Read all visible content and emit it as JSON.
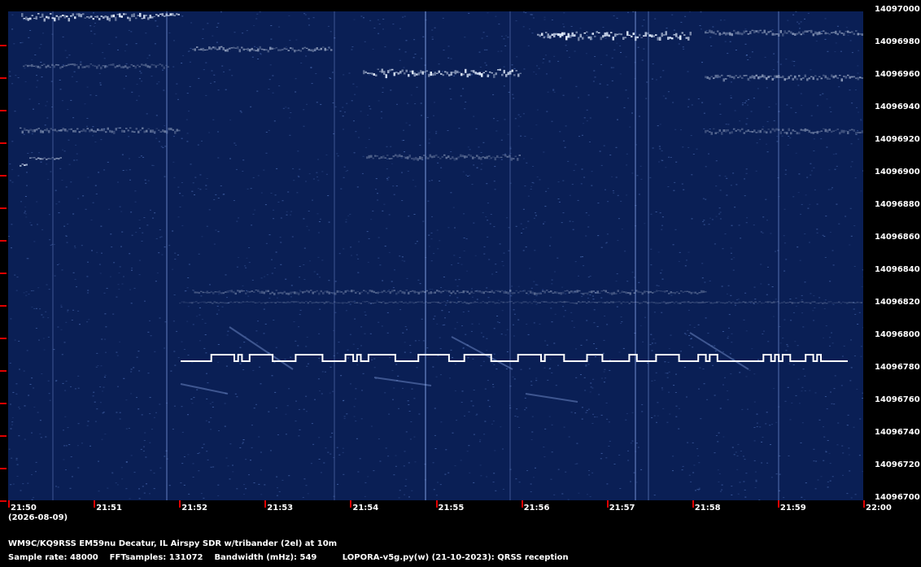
{
  "y_axis": {
    "labels": [
      "14097000",
      "14096980",
      "14096960",
      "14096940",
      "14096920",
      "14096900",
      "14096880",
      "14096860",
      "14096840",
      "14096820",
      "14096800",
      "14096780",
      "14096760",
      "14096740",
      "14096720",
      "14096700"
    ]
  },
  "x_axis": {
    "labels": [
      "21:50",
      "21:51",
      "21:52",
      "21:53",
      "21:54",
      "21:55",
      "21:56",
      "21:57",
      "21:58",
      "21:59",
      "22:00"
    ],
    "date": "(2026-08-09)"
  },
  "station": "WM9C/KQ9RSS EM59nu Decatur, IL  Airspy SDR w/tribander (2el) at 10m",
  "info": {
    "sample_rate": "Sample rate: 48000",
    "fft_samples": "FFTsamples: 131072",
    "bandwidth": "Bandwidth (mHz): 549",
    "software": "LOPORA-v5g.py(w) (21-10-2023): QRSS reception"
  },
  "colors": {
    "background": "#0a1f55",
    "signal": "#ffffff",
    "tick": "#e00000"
  },
  "fsk_pattern": [
    0,
    0,
    0,
    0,
    0,
    0,
    0,
    0,
    1,
    1,
    1,
    1,
    1,
    1,
    0,
    1,
    0,
    0,
    1,
    1,
    1,
    1,
    1,
    1,
    0,
    0,
    0,
    0,
    0,
    0,
    1,
    1,
    1,
    1,
    1,
    1,
    1,
    0,
    0,
    0,
    0,
    0,
    0,
    1,
    1,
    0,
    1,
    0,
    0,
    1,
    1,
    1,
    1,
    1,
    1,
    1,
    0,
    0,
    0,
    0,
    0,
    0,
    1,
    1,
    1,
    1,
    1,
    1,
    1,
    1,
    0,
    0,
    0,
    0,
    1,
    1,
    1,
    1,
    1,
    1,
    1,
    0,
    0,
    0,
    0,
    0,
    0,
    0,
    1,
    1,
    1,
    1,
    1,
    1,
    0,
    1,
    1,
    1,
    1,
    1,
    0,
    0,
    0,
    0,
    0,
    0,
    1,
    1,
    1,
    1,
    0,
    0,
    0,
    0,
    0,
    0,
    0,
    1,
    1,
    0,
    0,
    0,
    0,
    0,
    1,
    1,
    1,
    1,
    1,
    1,
    0,
    0,
    0,
    0,
    0,
    1,
    1,
    0,
    1,
    1,
    0,
    0,
    0,
    0,
    0,
    0,
    0,
    0,
    0,
    0,
    0,
    0,
    1,
    1,
    0,
    1,
    0,
    1,
    1,
    0,
    0,
    0,
    0,
    1,
    1,
    0,
    1,
    0,
    0,
    0,
    0,
    0,
    0,
    0
  ]
}
